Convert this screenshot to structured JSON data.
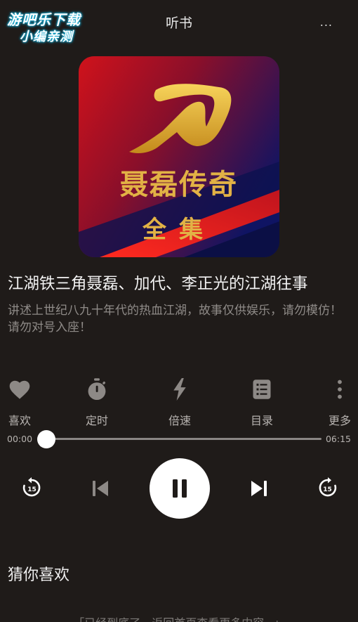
{
  "watermark": {
    "line1": "游吧乐下载",
    "line2": "小编亲测"
  },
  "header": {
    "title": "听书",
    "more": "..."
  },
  "cover": {
    "title_text": "聂磊传奇",
    "subtitle_text": "全集"
  },
  "book": {
    "title": "江湖铁三角聂磊、加代、李正光的江湖往事",
    "description": "讲述上世纪八九十年代的热血江湖，故事仅供娱乐，请勿模仿！请勿对号入座！"
  },
  "controls": [
    {
      "label": "喜欢",
      "icon": "heart-icon"
    },
    {
      "label": "定时",
      "icon": "timer-icon"
    },
    {
      "label": "倍速",
      "icon": "lightning-icon"
    },
    {
      "label": "目录",
      "icon": "list-icon"
    },
    {
      "label": "更多",
      "icon": "vertical-dots-icon"
    }
  ],
  "progress": {
    "current": "00:00",
    "total": "06:15",
    "fraction": 0.0
  },
  "player": {
    "rewind_seconds": "15",
    "forward_seconds": "15",
    "state": "playing"
  },
  "recommend": {
    "title": "猜你喜欢"
  },
  "footer": {
    "end_note": "「已经到底了，返回首页查看更多内容~」"
  },
  "colors": {
    "background": "#1f1b19",
    "icon_gray": "#8d8986",
    "label_gray": "#b7b3b0",
    "cover_red": "#c8101a",
    "cover_gold": "#e6b93b"
  }
}
